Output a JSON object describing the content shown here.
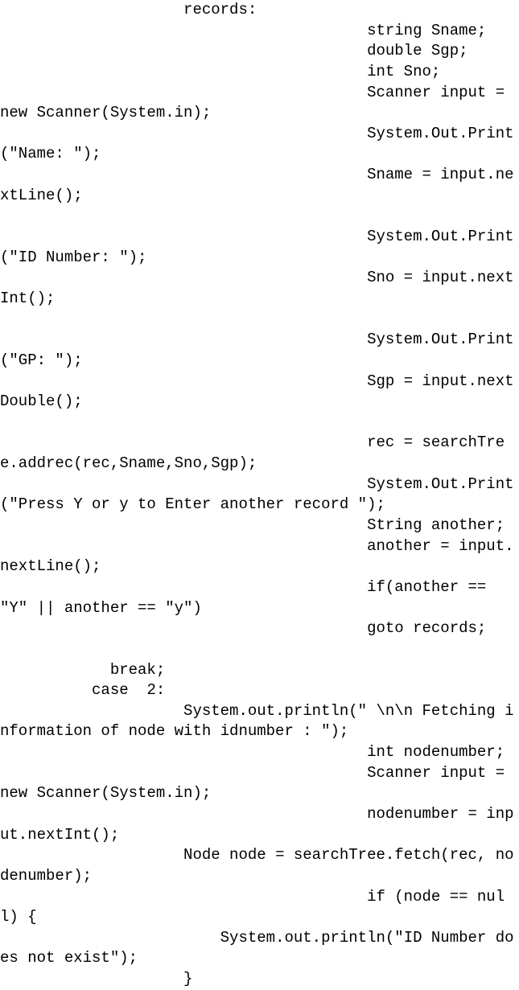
{
  "code": {
    "lines": [
      "                    records:",
      "                                        string Sname;",
      "                                        double Sgp;",
      "                                        int Sno;",
      "                                        Scanner input = new Scanner(System.in);",
      "                                        System.Out.Print(\"Name: \");",
      "                                        Sname = input.nextLine();",
      "",
      "                                        System.Out.Print(\"ID Number: \");",
      "                                        Sno = input.nextInt();",
      "",
      "                                        System.Out.Print(\"GP: \");",
      "                                        Sgp = input.nextDouble();",
      "",
      "                                        rec = searchTree.addrec(rec,Sname,Sno,Sgp);",
      "                                        System.Out.Print(\"Press Y or y to Enter another record \");",
      "                                        String another;",
      "                                        another = input.nextLine();",
      "                                        if(another == \"Y\" || another == \"y\")",
      "                                        goto records;",
      "",
      "            break;",
      "          case  2:",
      "                    System.out.println(\" \\n\\n Fetching information of node with idnumber : \");",
      "                                        int nodenumber;",
      "                                        Scanner input = new Scanner(System.in);",
      "                                        nodenumber = input.nextInt();",
      "                    Node node = searchTree.fetch(rec, nodenumber);",
      "                                        if (node == null) {",
      "                        System.out.println(\"ID Number does not exist\");",
      "                    }"
    ]
  }
}
